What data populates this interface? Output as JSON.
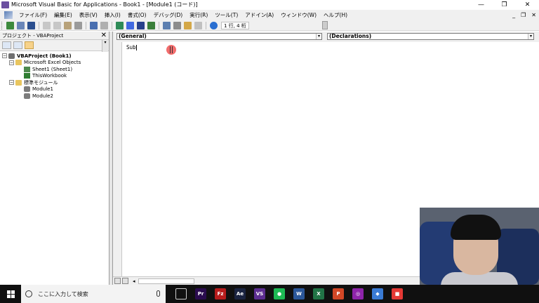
{
  "window": {
    "title": "Microsoft Visual Basic for Applications - Book1 - [Module1 (コード)]",
    "minimize": "—",
    "restore": "❐",
    "close": "✕"
  },
  "menu": {
    "items": [
      "ファイル(F)",
      "編集(E)",
      "表示(V)",
      "挿入(I)",
      "書式(O)",
      "デバッグ(D)",
      "実行(R)",
      "ツール(T)",
      "アドイン(A)",
      "ウィンドウ(W)",
      "ヘルプ(H)"
    ],
    "mdi_min": "_",
    "mdi_restore": "❐",
    "mdi_close": "✕"
  },
  "toolbar": {
    "position": "1 行, 4 桁"
  },
  "project": {
    "title": "プロジェクト - VBAProject",
    "close": "✕",
    "scroll_down": "▾",
    "root": "VBAProject (Book1)",
    "excel_objects": "Microsoft Excel Objects",
    "sheet1": "Sheet1 (Sheet1)",
    "this_workbook": "ThisWorkbook",
    "standard_modules": "標準モジュール",
    "module1": "Module1",
    "module2": "Module2",
    "expand_symbol": "−"
  },
  "code": {
    "object_combo": "(General)",
    "proc_combo": "(Declarations)",
    "dropdown_glyph": "▾",
    "line1": "Sub",
    "scroll_left": "◂"
  },
  "taskbar": {
    "search_placeholder": "ここに入力して検索",
    "apps": [
      {
        "label": "Pr",
        "color": "#2a0b4e"
      },
      {
        "label": "Fz",
        "color": "#b71c1c"
      },
      {
        "label": "Ae",
        "color": "#1a2340"
      },
      {
        "label": "VS",
        "color": "#5c2d91"
      },
      {
        "label": "●",
        "color": "#1db954"
      },
      {
        "label": "W",
        "color": "#2b579a"
      },
      {
        "label": "X",
        "color": "#217346"
      },
      {
        "label": "P",
        "color": "#d24726"
      },
      {
        "label": "◎",
        "color": "#8e24aa"
      },
      {
        "label": "◆",
        "color": "#3a7bd5"
      },
      {
        "label": "■",
        "color": "#e53935"
      }
    ]
  },
  "colors": {
    "accent_cursor": "#f26d6d",
    "taskbar": "#101010"
  }
}
